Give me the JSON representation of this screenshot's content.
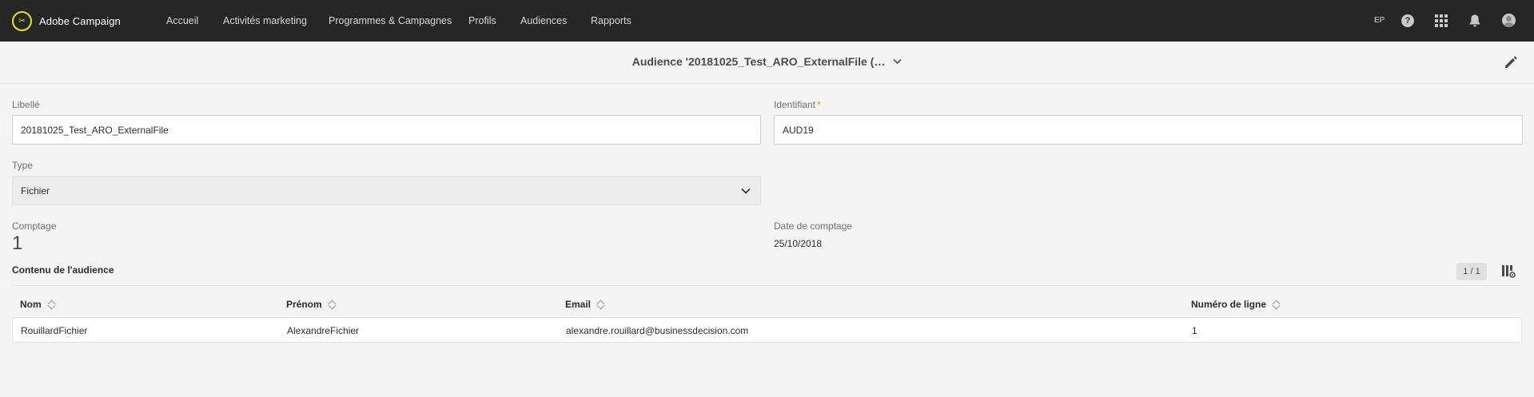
{
  "app": {
    "brand_name": "Adobe Campaign",
    "logo_glyph": "✂",
    "accent_color": "#e8e31c"
  },
  "nav": {
    "items": [
      {
        "label": "Accueil"
      },
      {
        "label": "Activités marketing"
      },
      {
        "label": "Programmes & Campagnes"
      },
      {
        "label": "Profils"
      },
      {
        "label": "Audiences"
      },
      {
        "label": "Rapports"
      }
    ]
  },
  "topright": {
    "user_initials": "EP",
    "help_glyph": "?",
    "icons": [
      "help-icon",
      "apps-grid-icon",
      "bell-icon",
      "user-avatar-icon"
    ]
  },
  "header": {
    "title": "Audience '20181025_Test_ARO_ExternalFile (…",
    "title_chevron": "⌄",
    "edit_icon": "pencil-icon"
  },
  "form": {
    "libelle_label": "Libellé",
    "libelle_value": "20181025_Test_ARO_ExternalFile",
    "identifiant_label": "Identifiant",
    "identifiant_required": "*",
    "identifiant_value": "AUD19",
    "type_label": "Type",
    "type_value": "Fichier",
    "comptage_label": "Comptage",
    "comptage_value": "1",
    "date_label": "Date de comptage",
    "date_value": "25/10/2018"
  },
  "content": {
    "title": "Contenu de l'audience",
    "pager": "1 / 1",
    "columns": [
      {
        "label": "Nom"
      },
      {
        "label": "Prénom"
      },
      {
        "label": "Email"
      },
      {
        "label": "Numéro de ligne"
      }
    ],
    "rows": [
      [
        "RouillardFichier",
        "AlexandreFichier",
        "alexandre.rouillard@businessdecision.com",
        "1"
      ]
    ]
  }
}
